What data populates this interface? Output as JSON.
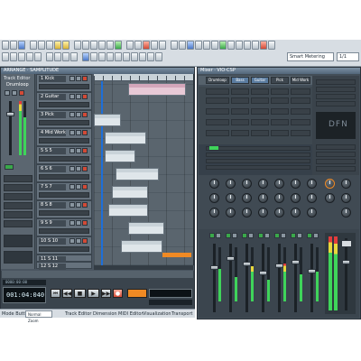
{
  "toolbar": {
    "preset_select": "Smart Metering",
    "zoom_select": "1/1"
  },
  "arrange": {
    "title": "ARRANGE · SAMPLITUDE",
    "inspector_label": "Track Editor",
    "drum_name": "Drumloop",
    "tracks": [
      {
        "num": "1",
        "name": "Kick"
      },
      {
        "num": "2",
        "name": "Guitar"
      },
      {
        "num": "3",
        "name": "Pick"
      },
      {
        "num": "4",
        "name": "Mid Work"
      },
      {
        "num": "5",
        "name": "S 5"
      },
      {
        "num": "6",
        "name": "S 6"
      },
      {
        "num": "7",
        "name": "S 7"
      },
      {
        "num": "8",
        "name": "S 8"
      },
      {
        "num": "9",
        "name": "S 9"
      },
      {
        "num": "10",
        "name": "S 10"
      },
      {
        "num": "11",
        "name": "S 11"
      },
      {
        "num": "12",
        "name": "S 12"
      }
    ]
  },
  "transport": {
    "time": "001:04:040",
    "sub_time": "0000:00:00",
    "bottom_select": "Normal Zoom"
  },
  "bottom_tabs": [
    "Mode Buttons",
    "Track Editor",
    "Dimension",
    "MIDI Editor",
    "Visualization",
    "Transport"
  ],
  "mixer": {
    "title": "Mixer · VIO-CSP",
    "channel_headers": [
      "Drumloop",
      "Bass",
      "Guitar",
      "Pick",
      "Mid Work"
    ],
    "logo": "DFN"
  },
  "colors": {
    "background": "#4a5560",
    "accent_orange": "#f08a24",
    "meter_green": "#3fd45a",
    "meter_red": "#e23c3c",
    "time_display": "#0c1216"
  }
}
